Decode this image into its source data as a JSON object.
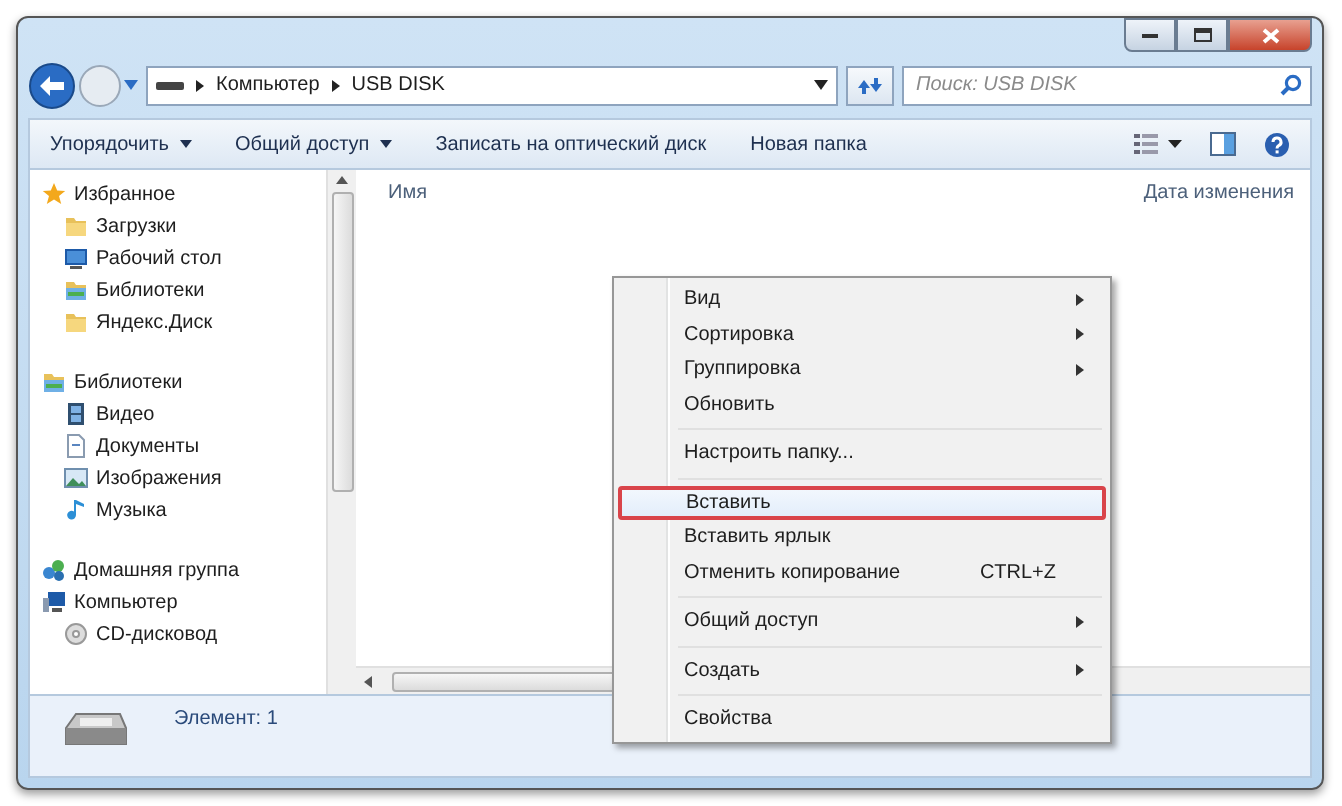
{
  "address": {
    "crumbs": [
      "Компьютер",
      "USB DISK"
    ]
  },
  "search": {
    "placeholder": "Поиск: USB DISK"
  },
  "toolbar": {
    "items": [
      {
        "label": "Упорядочить",
        "dropdown": true
      },
      {
        "label": "Общий доступ",
        "dropdown": true
      },
      {
        "label": "Записать на оптический диск",
        "dropdown": false
      },
      {
        "label": "Новая папка",
        "dropdown": false
      }
    ]
  },
  "nav": {
    "items": [
      {
        "label": "Избранное",
        "kind": "star",
        "children": [
          {
            "label": "Загрузки",
            "kind": "folder"
          },
          {
            "label": "Рабочий стол",
            "kind": "desktop"
          },
          {
            "label": "Библиотеки",
            "kind": "library"
          },
          {
            "label": "Яндекс.Диск",
            "kind": "folder"
          }
        ]
      },
      {
        "label": "Библиотеки",
        "kind": "library",
        "children": [
          {
            "label": "Видео",
            "kind": "video"
          },
          {
            "label": "Документы",
            "kind": "document"
          },
          {
            "label": "Изображения",
            "kind": "image"
          },
          {
            "label": "Музыка",
            "kind": "music"
          }
        ]
      },
      {
        "label": "Домашняя группа",
        "kind": "homegroup"
      },
      {
        "label": "Компьютер",
        "kind": "computer",
        "children": [
          {
            "label": "CD-дисковод",
            "kind": "drive"
          }
        ]
      }
    ]
  },
  "table": {
    "columns": [
      "Имя",
      "Дата изменения"
    ]
  },
  "status_bar": {
    "text": "Элемент: 1"
  },
  "context_menu": {
    "items": [
      {
        "kind": "item",
        "label": "Вид",
        "submenu": true,
        "highlighted": false
      },
      {
        "kind": "item",
        "label": "Сортировка",
        "submenu": true,
        "highlighted": false
      },
      {
        "kind": "item",
        "label": "Группировка",
        "submenu": true,
        "highlighted": false
      },
      {
        "kind": "item",
        "label": "Обновить",
        "submenu": false,
        "highlighted": false
      },
      {
        "kind": "separator"
      },
      {
        "kind": "item",
        "label": "Настроить папку...",
        "submenu": false,
        "highlighted": false
      },
      {
        "kind": "separator"
      },
      {
        "kind": "item",
        "label": "Вставить",
        "submenu": false,
        "highlighted": true
      },
      {
        "kind": "item",
        "label": "Вставить ярлык",
        "submenu": false,
        "highlighted": false
      },
      {
        "kind": "item",
        "label": "Отменить копирование",
        "shortcut": "CTRL+Z",
        "submenu": false,
        "highlighted": false
      },
      {
        "kind": "separator"
      },
      {
        "kind": "item",
        "label": "Общий доступ",
        "submenu": true,
        "highlighted": false
      },
      {
        "kind": "separator"
      },
      {
        "kind": "item",
        "label": "Создать",
        "submenu": true,
        "highlighted": false
      },
      {
        "kind": "separator"
      },
      {
        "kind": "item",
        "label": "Свойства",
        "submenu": false,
        "highlighted": false
      }
    ]
  }
}
